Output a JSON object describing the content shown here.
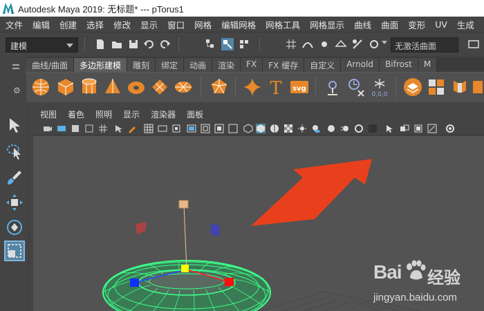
{
  "window": {
    "title": "Autodesk Maya 2019: 无标题*   ---   pTorus1"
  },
  "menubar": {
    "items": [
      "文件",
      "编辑",
      "创建",
      "选择",
      "修改",
      "显示",
      "窗口",
      "网格",
      "编辑网格",
      "网格工具",
      "网格显示",
      "曲线",
      "曲面",
      "变形",
      "UV",
      "生成"
    ]
  },
  "statusline": {
    "mode": "建模",
    "live_surface": "无激活曲面"
  },
  "shelf": {
    "tabs": [
      "曲线/曲面",
      "多边形建模",
      "雕刻",
      "绑定",
      "动画",
      "渲染",
      "FX",
      "FX 缓存",
      "自定义",
      "Arnold",
      "Bifrost",
      "M"
    ],
    "active_tab": "多边形建模",
    "text_tool": "T",
    "svg_tool": "svg",
    "vector_label": "0,0,0"
  },
  "panel": {
    "menus": [
      "视图",
      "着色",
      "照明",
      "显示",
      "渲染器",
      "面板"
    ]
  },
  "watermark": {
    "brand": "Bai",
    "cn": "经验",
    "url": "jingyan.baidu.com"
  },
  "colors": {
    "accent_blue": "#5285a6",
    "arrow_red": "#e8401c",
    "mesh_green": "#3dff8a",
    "shelf_orange": "#e8882a"
  }
}
